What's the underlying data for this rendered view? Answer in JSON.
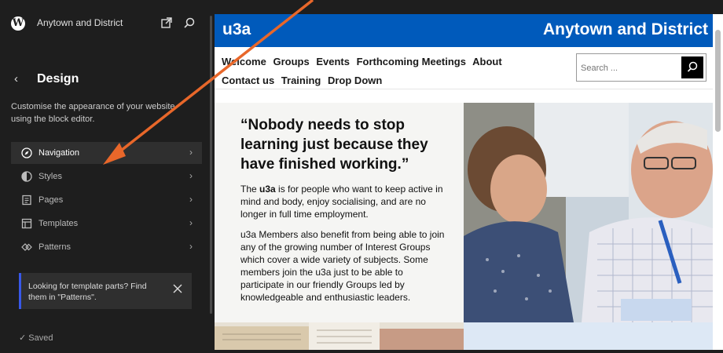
{
  "sidebar": {
    "site_title": "Anytown and District",
    "heading": "Design",
    "description": "Customise the appearance of your website using the block editor.",
    "items": [
      {
        "label": "Navigation",
        "icon": "navigation-icon",
        "active": true
      },
      {
        "label": "Styles",
        "icon": "styles-icon",
        "active": false
      },
      {
        "label": "Pages",
        "icon": "pages-icon",
        "active": false
      },
      {
        "label": "Templates",
        "icon": "templates-icon",
        "active": false
      },
      {
        "label": "Patterns",
        "icon": "patterns-icon",
        "active": false
      }
    ],
    "notice": "Looking for template parts? Find them in \"Patterns\".",
    "saved": "Saved",
    "saved_check": "✓",
    "chevron": "›",
    "back": "‹"
  },
  "preview": {
    "logo": "u3a",
    "site_name": "Anytown and District",
    "menu": [
      "Welcome",
      "Groups",
      "Events",
      "Forthcoming Meetings",
      "About",
      "Contact us",
      "Training",
      "Drop Down"
    ],
    "search_placeholder": "Search ...",
    "quote": "“Nobody needs to stop learning just because they have finished working.”",
    "para1_prefix": "The ",
    "para1_bold": "u3a",
    "para1_rest": " is for people who want to keep active in mind and body, enjoy socialising, and are no longer in full time employment.",
    "para2": "u3a Members also benefit from being able to join any of the growing number of Interest Groups which cover a wide variety of subjects. Some members join the u3a just to be able to participate in our friendly Groups led by knowledgeable and enthusiastic leaders."
  },
  "colors": {
    "sidebar_bg": "#1e1e1e",
    "header_blue": "#005abb",
    "annotation_arrow": "#e8672a",
    "accent": "#3858e9"
  }
}
